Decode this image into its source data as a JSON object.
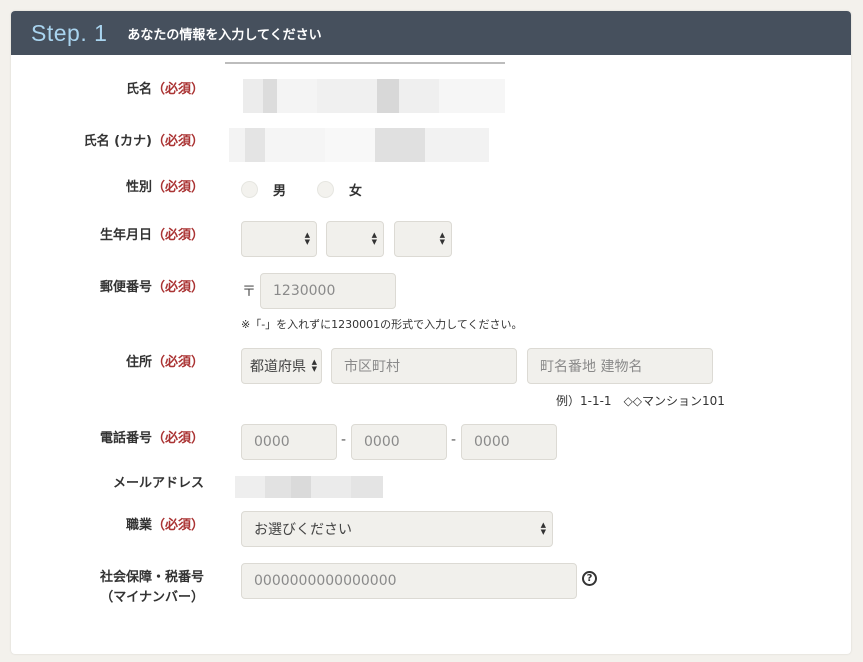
{
  "header": {
    "step": "Step. 1",
    "title": "あなたの情報を入力してください"
  },
  "required_mark": "（必須）",
  "fields": {
    "name": {
      "label": "氏名"
    },
    "kana": {
      "label": "氏名 (カナ)"
    },
    "gender": {
      "label": "性別",
      "options": [
        "男",
        "女"
      ]
    },
    "birthday": {
      "label": "生年月日"
    },
    "postal": {
      "label": "郵便番号",
      "prefix": "〒",
      "placeholder": "1230000",
      "note": "※「-」を入れずに1230001の形式で入力してください。"
    },
    "address": {
      "label": "住所",
      "prefecture": "都道府県",
      "city_placeholder": "市区町村",
      "street_placeholder": "町名番地 建物名",
      "example": "例）1-1-1　◇◇マンション101"
    },
    "phone": {
      "label": "電話番号",
      "placeholders": [
        "0000",
        "0000",
        "0000"
      ],
      "separator": "-"
    },
    "email": {
      "label": "メールアドレス"
    },
    "job": {
      "label": "職業",
      "selected": "お選びください"
    },
    "mynumber": {
      "label_line1": "社会保障・税番号",
      "label_line2": "（マイナンバー）",
      "placeholder": "0000000000000000",
      "help": "?"
    }
  }
}
